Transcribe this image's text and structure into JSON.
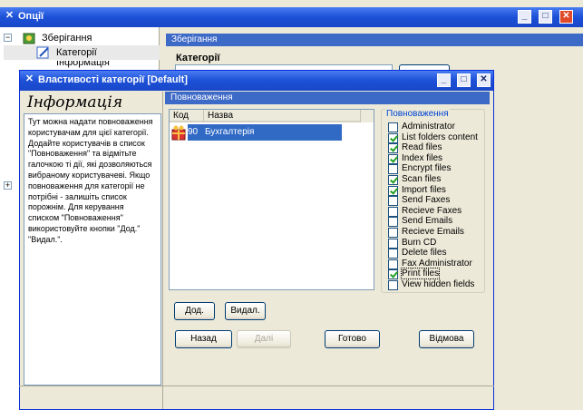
{
  "background_window": {
    "title": "Опції",
    "tree": [
      {
        "label": "Зберігання"
      },
      {
        "label": "Категорії"
      },
      {
        "label": "Інформація"
      }
    ],
    "section_header": "Зберігання",
    "section_label": "Категорії"
  },
  "dialog": {
    "title": "Властивості категорії [Default]",
    "info_heading": "Інформація",
    "info_text": "Тут можна надати повноваження користувачам для цієї категорії. Додайте користувачів в список \"Повноваження\" та відмітьте галочкою ті дії, які дозволяються вибраному користувачеві. Якщо повноваження для категорії не потрібні - залишіть список порожнім. Для керування списком \"Повноваження\" використовуйте кнопки \"Дод.\" \"Видал.\".",
    "permissions_header": "Повноваження",
    "list": {
      "columns": [
        "Код",
        "Назва"
      ],
      "rows": [
        {
          "code": "90",
          "name": "Бухгалтерія"
        }
      ]
    },
    "permissions_group_label": "Повноваження",
    "permissions": [
      {
        "label": "Administrator",
        "checked": false
      },
      {
        "label": "List folders content",
        "checked": true
      },
      {
        "label": "Read files",
        "checked": true
      },
      {
        "label": "Index files",
        "checked": true
      },
      {
        "label": "Encrypt files",
        "checked": false
      },
      {
        "label": "Scan files",
        "checked": true
      },
      {
        "label": "Import files",
        "checked": true
      },
      {
        "label": "Send Faxes",
        "checked": false
      },
      {
        "label": "Recieve Faxes",
        "checked": false
      },
      {
        "label": "Send Emails",
        "checked": false
      },
      {
        "label": "Recieve Emails",
        "checked": false
      },
      {
        "label": "Burn CD",
        "checked": false
      },
      {
        "label": "Delete files",
        "checked": false
      },
      {
        "label": "Fax Administrator",
        "checked": false
      },
      {
        "label": "Print files",
        "checked": true
      },
      {
        "label": "View hidden fields",
        "checked": false
      }
    ],
    "buttons": {
      "add": "Дод.",
      "remove": "Видал.",
      "back": "Назад",
      "next": "Далі",
      "done": "Готово",
      "cancel": "Відмова"
    }
  }
}
